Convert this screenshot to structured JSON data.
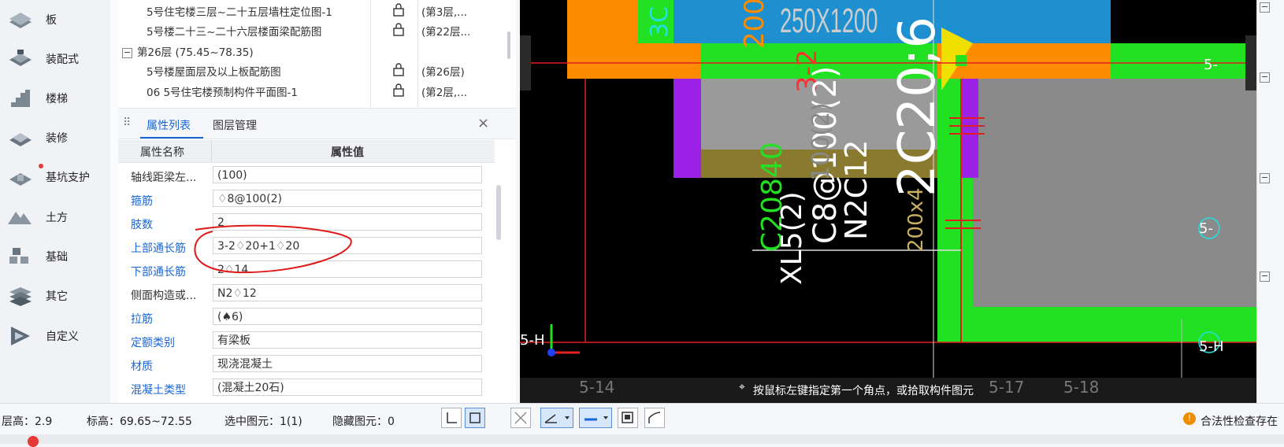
{
  "nav": {
    "items": [
      {
        "label": "板",
        "icon": "slab-icon"
      },
      {
        "label": "装配式",
        "icon": "prefab-icon"
      },
      {
        "label": "楼梯",
        "icon": "stair-icon"
      },
      {
        "label": "装修",
        "icon": "decoration-icon"
      },
      {
        "label": "基坑支护",
        "icon": "foundation-pit-icon"
      },
      {
        "label": "土方",
        "icon": "earthwork-icon"
      },
      {
        "label": "基础",
        "icon": "foundation-icon"
      },
      {
        "label": "其它",
        "icon": "other-icon"
      },
      {
        "label": "自定义",
        "icon": "custom-icon"
      }
    ]
  },
  "tree": {
    "rows": [
      {
        "name": "5号住宅楼三层~二十五层墙柱定位图-1",
        "floor": "(第3层,..."
      },
      {
        "name": "5号楼二十三~二十六层楼面梁配筋图",
        "floor": "(第22层..."
      },
      {
        "group": "第26层 (75.45~78.35)"
      },
      {
        "name": "5号楼屋面层及以上板配筋图",
        "floor": "(第26层)"
      },
      {
        "name": "06 5号住宅楼预制构件平面图-1",
        "floor": "(第2层,..."
      }
    ]
  },
  "props": {
    "tabs": [
      "属性列表",
      "图层管理"
    ],
    "header": {
      "name": "属性名称",
      "value": "属性值"
    },
    "rows": [
      {
        "name": "轴线距梁左...",
        "value": "(100)",
        "link": false
      },
      {
        "name": "箍筋",
        "value": "♢8@100(2)",
        "link": true
      },
      {
        "name": "肢数",
        "value": "2",
        "link": true
      },
      {
        "name": "上部通长筋",
        "value": "3-2♢20+1♢20",
        "link": true
      },
      {
        "name": "下部通长筋",
        "value": "2♢14",
        "link": true
      },
      {
        "name": "侧面构造或...",
        "value": "N2♢12",
        "link": false
      },
      {
        "name": "拉筋",
        "value": "(♠6)",
        "link": true
      },
      {
        "name": "定额类别",
        "value": "有梁板",
        "link": true
      },
      {
        "name": "材质",
        "value": "现浇混凝土",
        "link": true
      },
      {
        "name": "混凝土类型",
        "value": "(混凝土20石)",
        "link": true
      }
    ]
  },
  "canvas": {
    "texts": {
      "beam_size": "250X1200",
      "rebar_main": "2C20;6",
      "stirrup": "C8@100(2)",
      "side_bar": "N2C12",
      "beam_name": "XL5(2)",
      "axis_h": "5-H",
      "axis_14": "5-14",
      "axis_17": "5-17",
      "axis_18": "5-18",
      "axis_5": "5-",
      "axis_h2": "5-H",
      "vert_a": "3C",
      "vert_b": "200",
      "vert_c": "3-2",
      "vert_d": "C20840",
      "vert_e": "200x4",
      "vert_f": "100(2)"
    },
    "hint": "按鼠标左键指定第一个角点，或拾取构件图元"
  },
  "status": {
    "floor_height": "层高：2.9",
    "elevation": "标高：69.65~72.55",
    "selected": "选中图元：1(1)",
    "hidden": "隐藏图元：0",
    "legality": "合法性检查存在"
  },
  "colors": {
    "accent": "#1a66d6",
    "canvas_bg": "#000000",
    "beam_orange": "#ff8c00",
    "beam_green": "#22e022",
    "wall_blue": "#1e90d0",
    "magenta": "#9b22e6"
  }
}
